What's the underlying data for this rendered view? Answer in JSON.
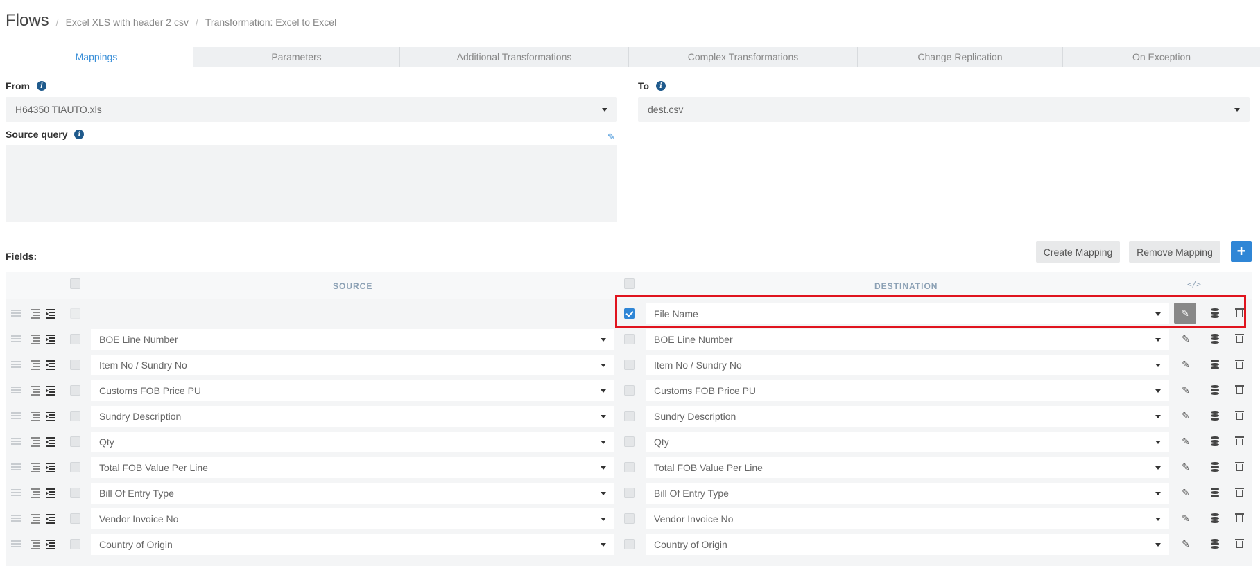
{
  "header": {
    "title": "Flows",
    "breadcrumb": [
      "Excel XLS with header 2 csv",
      "Transformation: Excel to Excel"
    ]
  },
  "tabs": [
    {
      "label": "Mappings",
      "active": true
    },
    {
      "label": "Parameters"
    },
    {
      "label": "Additional Transformations"
    },
    {
      "label": "Complex Transformations"
    },
    {
      "label": "Change Replication"
    },
    {
      "label": "On Exception"
    }
  ],
  "from": {
    "label": "From",
    "value": "H64350 TIAUTO.xls"
  },
  "to": {
    "label": "To",
    "value": "dest.csv"
  },
  "source_query": {
    "label": "Source query",
    "value": ""
  },
  "fields": {
    "label": "Fields:",
    "create_mapping": "Create Mapping",
    "remove_mapping": "Remove Mapping",
    "add": "+",
    "source_header": "SOURCE",
    "destination_header": "DESTINATION",
    "code_toggle": "</>"
  },
  "rows": [
    {
      "source": "",
      "destination": "File Name",
      "checked": true
    },
    {
      "source": "BOE Line Number",
      "destination": "BOE Line Number"
    },
    {
      "source": "Item No / Sundry No",
      "destination": "Item No / Sundry No"
    },
    {
      "source": "Customs FOB Price PU",
      "destination": "Customs FOB Price PU"
    },
    {
      "source": "Sundry Description",
      "destination": "Sundry Description"
    },
    {
      "source": "Qty",
      "destination": "Qty"
    },
    {
      "source": "Total FOB Value Per Line",
      "destination": "Total FOB Value Per Line"
    },
    {
      "source": "Bill Of Entry Type",
      "destination": "Bill Of Entry Type"
    },
    {
      "source": "Vendor Invoice No",
      "destination": "Vendor Invoice No"
    },
    {
      "source": "Country of Origin",
      "destination": "Country of Origin"
    }
  ],
  "colors": {
    "accent": "#2f86d6",
    "highlight": "#e0141e"
  }
}
